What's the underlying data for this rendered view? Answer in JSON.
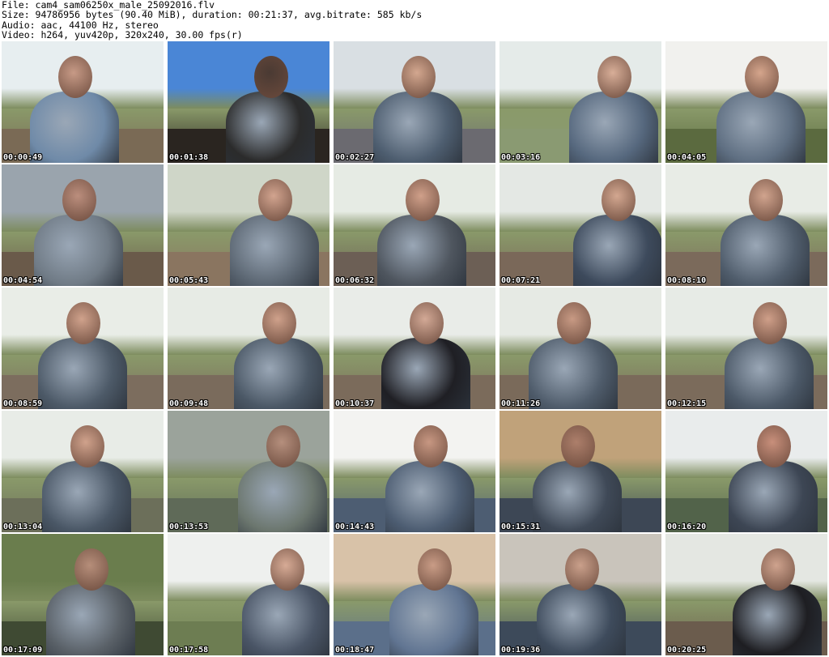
{
  "header": {
    "file": "File: cam4_sam06250x_male_25092016.flv",
    "size": "Size: 94786956 bytes (90.40 MiB), duration: 00:21:37, avg.bitrate: 585 kb/s",
    "audio": "Audio: aac, 44100 Hz, stereo",
    "video": "Video: h264, yuv420p, 320x240, 30.00 fps(r)"
  },
  "thumbnails": [
    {
      "timestamp": "00:00:49",
      "sky": "#e7eef0",
      "ground": "#7a6a55",
      "shirt": "#6f8aa8",
      "skin": "#c79a86"
    },
    {
      "timestamp": "00:01:38",
      "sky": "#4a86d6",
      "ground": "#2a2520",
      "shirt": "#2b2b2b",
      "skin": "#4a3a33"
    },
    {
      "timestamp": "00:02:27",
      "sky": "#d9dfe3",
      "ground": "#6b6a70",
      "shirt": "#4e5e70",
      "skin": "#d3a78f"
    },
    {
      "timestamp": "00:03:16",
      "sky": "#e5ebe9",
      "ground": "#8a9a72",
      "shirt": "#56687e",
      "skin": "#d8ae98"
    },
    {
      "timestamp": "00:04:05",
      "sky": "#f1f1ee",
      "ground": "#5b6a3f",
      "shirt": "#5f6f82",
      "skin": "#d5a58c"
    },
    {
      "timestamp": "00:04:54",
      "sky": "#9aa4ad",
      "ground": "#6a5a4a",
      "shirt": "#707b86",
      "skin": "#bb8e7d"
    },
    {
      "timestamp": "00:05:43",
      "sky": "#cfd6c8",
      "ground": "#8a7560",
      "shirt": "#5c6773",
      "skin": "#d2a48f"
    },
    {
      "timestamp": "00:06:32",
      "sky": "#e6ebe4",
      "ground": "#6c5f55",
      "shirt": "#4f565f",
      "skin": "#d0a08a"
    },
    {
      "timestamp": "00:07:21",
      "sky": "#e4e8e4",
      "ground": "#7a6859",
      "shirt": "#3d4a5c",
      "skin": "#d3a790"
    },
    {
      "timestamp": "00:08:10",
      "sky": "#e8ece6",
      "ground": "#7b6a5b",
      "shirt": "#505d6c",
      "skin": "#d1a48e"
    },
    {
      "timestamp": "00:08:59",
      "sky": "#e9ede7",
      "ground": "#7c6d5e",
      "shirt": "#4d5a68",
      "skin": "#d0a28c"
    },
    {
      "timestamp": "00:09:48",
      "sky": "#e7ebe5",
      "ground": "#7a6b5c",
      "shirt": "#4b5866",
      "skin": "#cfa18b"
    },
    {
      "timestamp": "00:10:37",
      "sky": "#e9ece8",
      "ground": "#7b6b5b",
      "shirt": "#1f1f24",
      "skin": "#d3a996"
    },
    {
      "timestamp": "00:11:26",
      "sky": "#e6eae4",
      "ground": "#7a6a5a",
      "shirt": "#4f5c6b",
      "skin": "#c89a84"
    },
    {
      "timestamp": "00:12:15",
      "sky": "#e7ebe6",
      "ground": "#7b6b5b",
      "shirt": "#4c5968",
      "skin": "#cf9f89"
    },
    {
      "timestamp": "00:13:04",
      "sky": "#e8ece7",
      "ground": "#6c6f5a",
      "shirt": "#4a5766",
      "skin": "#d0a28c"
    },
    {
      "timestamp": "00:13:53",
      "sky": "#9ba39b",
      "ground": "#5f6a58",
      "shirt": "#6c776f",
      "skin": "#b58f7d"
    },
    {
      "timestamp": "00:14:43",
      "sky": "#f3f3f1",
      "ground": "#4d5d72",
      "shirt": "#4d5d72",
      "skin": "#c79782"
    },
    {
      "timestamp": "00:15:31",
      "sky": "#c0a27a",
      "ground": "#3d4755",
      "shirt": "#3f4957",
      "skin": "#ad7f6b"
    },
    {
      "timestamp": "00:16:20",
      "sky": "#e9ecec",
      "ground": "#52634a",
      "shirt": "#3d4654",
      "skin": "#c88f7b"
    },
    {
      "timestamp": "00:17:09",
      "sky": "#6a7d4d",
      "ground": "#3f4a33",
      "shirt": "#5a6168",
      "skin": "#b68e7a"
    },
    {
      "timestamp": "00:17:58",
      "sky": "#eef0ee",
      "ground": "#6d7d52",
      "shirt": "#4a5566",
      "skin": "#d7ab96"
    },
    {
      "timestamp": "00:18:47",
      "sky": "#d8c2a8",
      "ground": "#5b6f8a",
      "shirt": "#617592",
      "skin": "#c99c86"
    },
    {
      "timestamp": "00:19:36",
      "sky": "#c9c4bb",
      "ground": "#3d4a5a",
      "shirt": "#3e4b5c",
      "skin": "#caa08b"
    },
    {
      "timestamp": "00:20:25",
      "sky": "#e4e7e2",
      "ground": "#6b5c4d",
      "shirt": "#1e1e22",
      "skin": "#cfa38e"
    }
  ]
}
